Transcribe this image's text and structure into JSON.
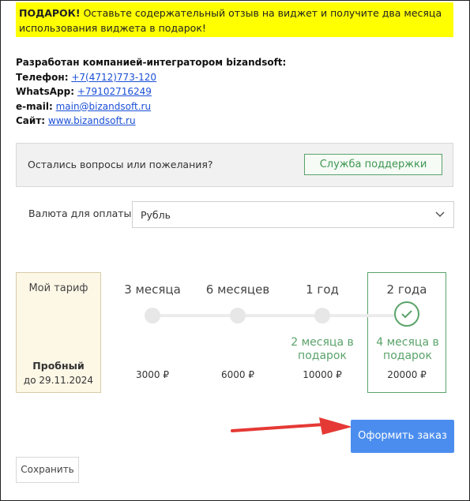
{
  "gift": {
    "bold": "ПОДАРОК!",
    "text": " Оставьте содержательный отзыв на виджет и получите два месяца использования виджета в подарок!"
  },
  "contacts": {
    "developer": "Разработан компанией-интегратором bizandsoft:",
    "phone_label": "Телефон:",
    "phone": "+7(4712)773-120",
    "whatsapp_label": "WhatsApp:",
    "whatsapp": "+79102716249",
    "email_label": "e-mail:",
    "email": "main@bizandsoft.ru",
    "site_label": "Сайт:",
    "site": "www.bizandsoft.ru"
  },
  "support": {
    "question": "Остались вопросы или пожелания?",
    "button": "Служба поддержки"
  },
  "currency": {
    "label": "Валюта для оплаты",
    "value": "Рубль"
  },
  "my_plan": {
    "title": "Мой тариф",
    "name": "Пробный",
    "until": "до 29.11.2024"
  },
  "plans": [
    {
      "period": "3 месяца",
      "bonus": "",
      "price": "3000 ₽"
    },
    {
      "period": "6 месяцев",
      "bonus": "",
      "price": "6000 ₽"
    },
    {
      "period": "1 год",
      "bonus": "2 месяца в подарок",
      "price": "10000 ₽"
    },
    {
      "period": "2 года",
      "bonus": "4 месяца в подарок",
      "price": "20000 ₽",
      "selected": true
    }
  ],
  "actions": {
    "order": "Оформить заказ",
    "save": "Сохранить"
  },
  "colors": {
    "gift_bg": "#ffff00",
    "accent_green": "#5aa36a",
    "order_blue": "#4b8def",
    "arrow_red": "#e53935"
  }
}
